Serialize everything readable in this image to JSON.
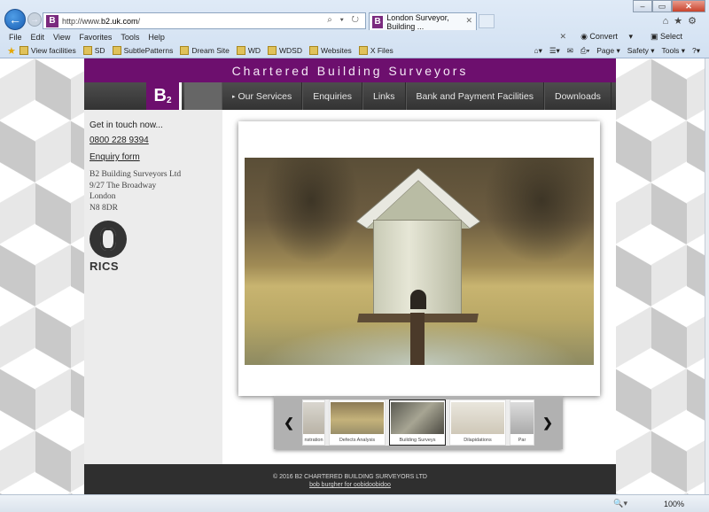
{
  "browser": {
    "url_prefix": "http://www.",
    "url_domain": "b2.uk.com",
    "url_suffix": "/",
    "tab_title": "London Surveyor, Building ...",
    "address_tools": "⌕ ▾ ↻",
    "menu": [
      "File",
      "Edit",
      "View",
      "Favorites",
      "Tools",
      "Help"
    ],
    "convert_label": "Convert",
    "select_label": "Select",
    "favorites": [
      "View facilities",
      "SD",
      "SubtlePatterns",
      "Dream Site",
      "WD",
      "WDSD",
      "Websites",
      "X Files"
    ],
    "toolbar": [
      "Page",
      "Safety",
      "Tools"
    ],
    "zoom": "100%"
  },
  "site": {
    "banner": "Chartered Building Surveyors",
    "logo_main": "B",
    "logo_sub": "2",
    "nav": [
      "Our Services",
      "Enquiries",
      "Links",
      "Bank and Payment Facilities",
      "Downloads"
    ],
    "sidebar": {
      "get_in_touch": "Get in touch now...",
      "phone": "0800 228 9394",
      "enquiry": "Enquiry form",
      "address": [
        "B2 Building Surveyors Ltd",
        "9/27 The Broadway",
        "London",
        "N8 8DR"
      ],
      "rics_text": "RICS"
    },
    "thumbnails": [
      "nstration",
      "Defects Analysis",
      "Building Surveys",
      "Dilapidations",
      "Par"
    ],
    "footer_copyright": "© 2016 B2 CHARTERED BUILDING SURVEYORS LTD",
    "footer_credit": "bob burgher for oobidoobidoo"
  },
  "colors": {
    "brand_purple": "#6d0f6e",
    "nav_dark": "#3b3b3b"
  }
}
